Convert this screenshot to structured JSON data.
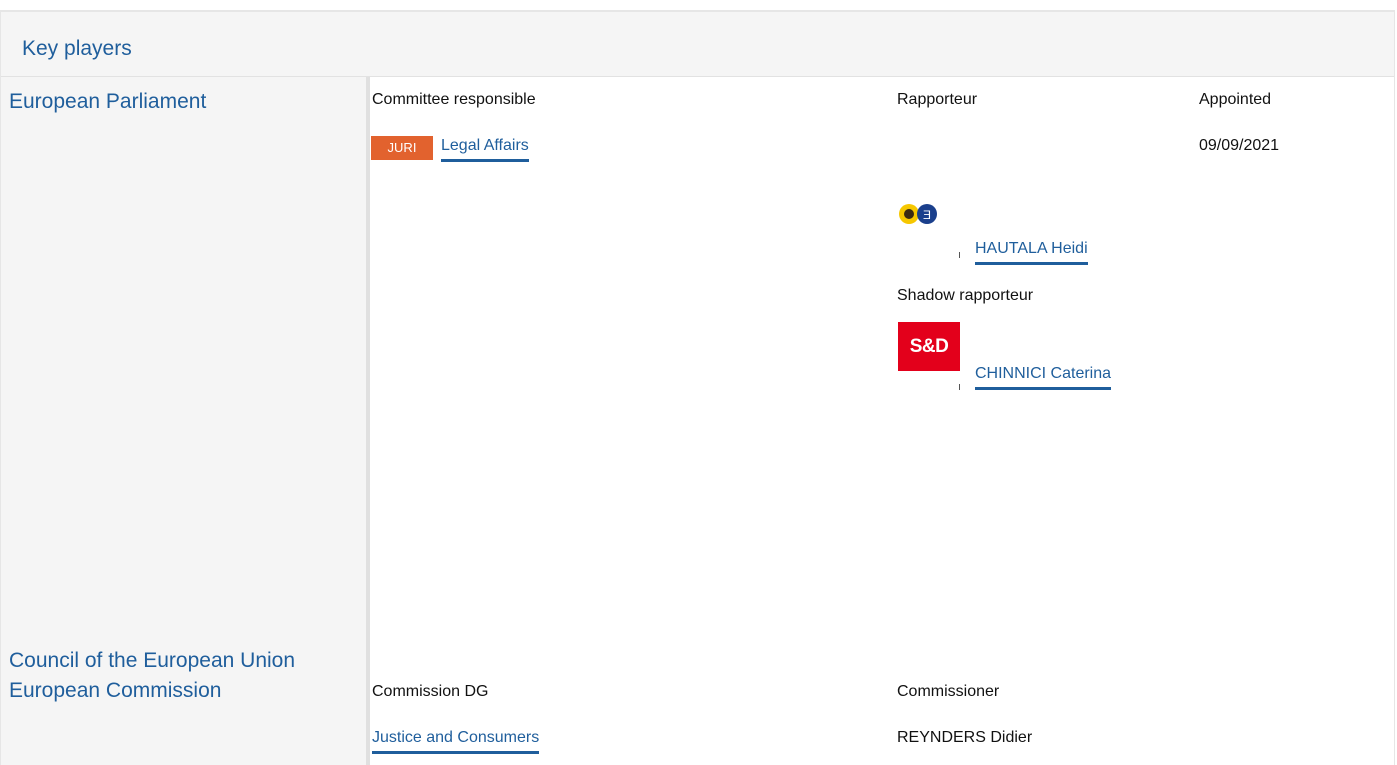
{
  "header": {
    "title": "Key players"
  },
  "institutions": {
    "parliament": "European Parliament",
    "council": "Council of the European Union",
    "commission": "European Commission"
  },
  "parliament": {
    "col_committee": "Committee responsible",
    "col_rapporteur": "Rapporteur",
    "col_appointed": "Appointed",
    "committee_code": "JURI",
    "committee_name": "Legal Affairs",
    "appointed_date": "09/09/2021",
    "rapporteur_name": "HAUTALA Heidi",
    "shadow_label": "Shadow rapporteur",
    "shadow_logo_text": "S&D",
    "shadow_name": "CHINNICI Caterina"
  },
  "commission": {
    "col_dg": "Commission DG",
    "col_commissioner": "Commissioner",
    "dg_name": "Justice and Consumers",
    "commissioner_name": "REYNDERS Didier"
  },
  "colors": {
    "link": "#1f5e9c",
    "badge": "#e2622e",
    "sd_red": "#e3001b"
  }
}
